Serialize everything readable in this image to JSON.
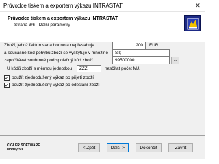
{
  "window": {
    "title": "Průvodce tiskem a exportem výkazu INTRASTAT",
    "close_glyph": "✕"
  },
  "header": {
    "title": "Průvodce tiskem a exportem výkazu INTRASTAT",
    "subtitle": "Strana 3/6 - Další parametry"
  },
  "form": {
    "value_limit_label": "Zboží, jehož fakturovaná hodnota nepřesahuje",
    "value_limit": "200",
    "value_limit_unit": "EUR",
    "movement_code_label": "a současně kód pohybu zboží se vyskytuje v množině",
    "movement_code": "ST;",
    "combined_code_label": "započítávat souhrnně pod společný kód zboží",
    "combined_code": "99500000",
    "ellipsis_label": "...",
    "unit_codes_label": "U kódů zboží s měrnou jednotkou",
    "unit_code": "ZZZ",
    "unit_codes_suffix": "nesčítat počet MJ.",
    "checkbox_arrival_label": "použít zjednodušený výkaz po přijetí zboží",
    "checkbox_arrival_checked": true,
    "checkbox_dispatch_label": "použít zjednodušený výkaz po odeslání zboží",
    "checkbox_dispatch_checked": true,
    "check_glyph": "✓"
  },
  "footer": {
    "brand_line1": "CÍGLER SOFTWARE",
    "brand_line2": "Money S3",
    "back_label": "< Zpět",
    "next_label": "Další >",
    "finish_label": "Dokončit",
    "close_label": "Zavřít"
  }
}
